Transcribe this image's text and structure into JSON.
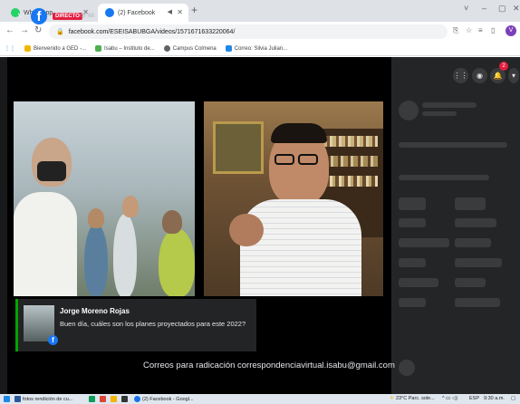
{
  "browser": {
    "tabs": [
      {
        "label": "WhatsApp",
        "favicon_color": "#25d366"
      },
      {
        "label": "(2) Facebook",
        "favicon_color": "#1877f2",
        "active": true
      }
    ],
    "new_tab": "+",
    "window_controls": [
      "˅",
      "–",
      "▢",
      "✕"
    ],
    "url": "facebook.com/ESEISABUBGA/videos/1571671633220064/",
    "profile_initial": "V",
    "bookmarks": [
      {
        "label": "Bienvenido a GED -...",
        "color": "#f4b400"
      },
      {
        "label": "Isabu – Instituto de...",
        "color": "#4caf50"
      },
      {
        "label": "Campus Colmena",
        "color": "#5f6368"
      },
      {
        "label": "Correo: Silvia Julian...",
        "color": "#1e88e5"
      }
    ]
  },
  "live": {
    "close": "✕",
    "logo": "f",
    "badge": "DIRECTO",
    "viewers": "👁 68"
  },
  "top_icons": {
    "grid": "⋮⋮",
    "messenger": "◉",
    "bell": "🔔",
    "account": "▾",
    "notification_count": "2"
  },
  "comment": {
    "author": "Jorge Moreno Rojas",
    "text": "Buen día, cuáles son los planes proyectados para este 2022?",
    "fb_mark": "f"
  },
  "banner": "Correos para radicación correspondenciavirtual.isabu@gmail.com",
  "taskbar": {
    "items": [
      {
        "label": "fotos rendición de cu..."
      },
      {
        "label": "(2) Facebook - Googl..."
      }
    ],
    "weather": "23°C  Parc. sole...",
    "lang": "ESP",
    "time": "9:30 a.m."
  },
  "colors": {
    "facebook_blue": "#1877f2",
    "live_red": "#e41e3f",
    "comment_accent": "#00a400"
  }
}
